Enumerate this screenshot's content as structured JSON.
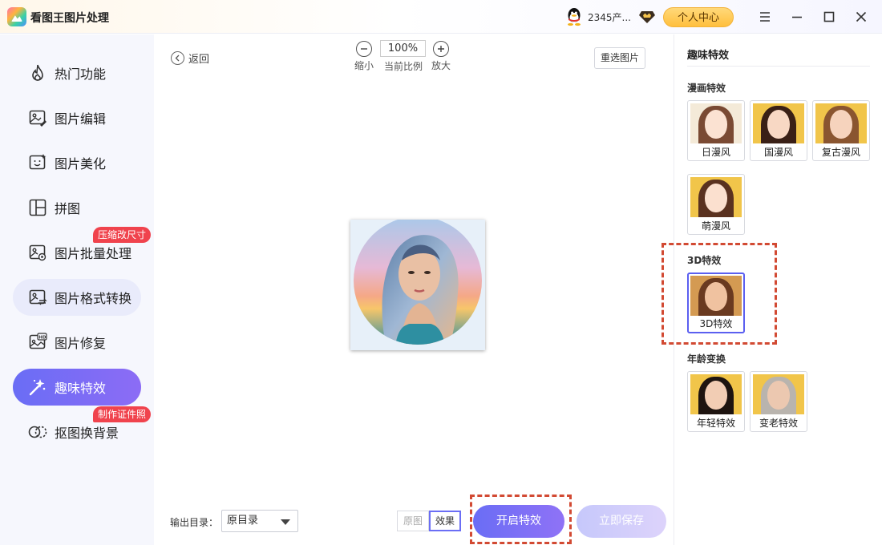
{
  "app": {
    "title": "看图王图片处理",
    "user_name": "2345产...",
    "center_button": "个人中心"
  },
  "sidebar": {
    "items": [
      {
        "label": "热门功能",
        "icon": "flame-icon"
      },
      {
        "label": "图片编辑",
        "icon": "image-edit-icon"
      },
      {
        "label": "图片美化",
        "icon": "image-beautify-icon"
      },
      {
        "label": "拼图",
        "icon": "collage-icon"
      },
      {
        "label": "图片批量处理",
        "icon": "batch-image-icon",
        "badge": "压缩改尺寸"
      },
      {
        "label": "图片格式转换",
        "icon": "format-convert-icon"
      },
      {
        "label": "图片修复",
        "icon": "hd-repair-icon"
      },
      {
        "label": "趣味特效",
        "icon": "magic-wand-icon"
      },
      {
        "label": "抠图换背景",
        "icon": "cutout-icon",
        "badge": "制作证件照"
      }
    ]
  },
  "toolbar": {
    "back_label": "返回",
    "zoom_out_label": "缩小",
    "zoom_value": "100%",
    "zoom_current_label": "当前比例",
    "zoom_in_label": "放大",
    "reselect_label": "重选图片"
  },
  "footer": {
    "output_label": "输出目录：",
    "output_value": "原目录",
    "view_original": "原图",
    "view_effect": "效果",
    "start_button": "开启特效",
    "save_button": "立即保存"
  },
  "panel": {
    "title": "趣味特效",
    "sections": [
      {
        "title": "漫画特效",
        "items": [
          "日漫风",
          "国漫风",
          "复古漫风",
          "萌漫风"
        ]
      },
      {
        "title": "3D特效",
        "items": [
          "3D特效"
        ],
        "selected": "3D特效"
      },
      {
        "title": "年龄变换",
        "items": [
          "年轻特效",
          "变老特效"
        ]
      }
    ]
  },
  "colors": {
    "accent": "#6b6ef5",
    "badge": "#f0434d",
    "highlight_dash": "#d24a33",
    "vip_button": "#ffc34a"
  }
}
